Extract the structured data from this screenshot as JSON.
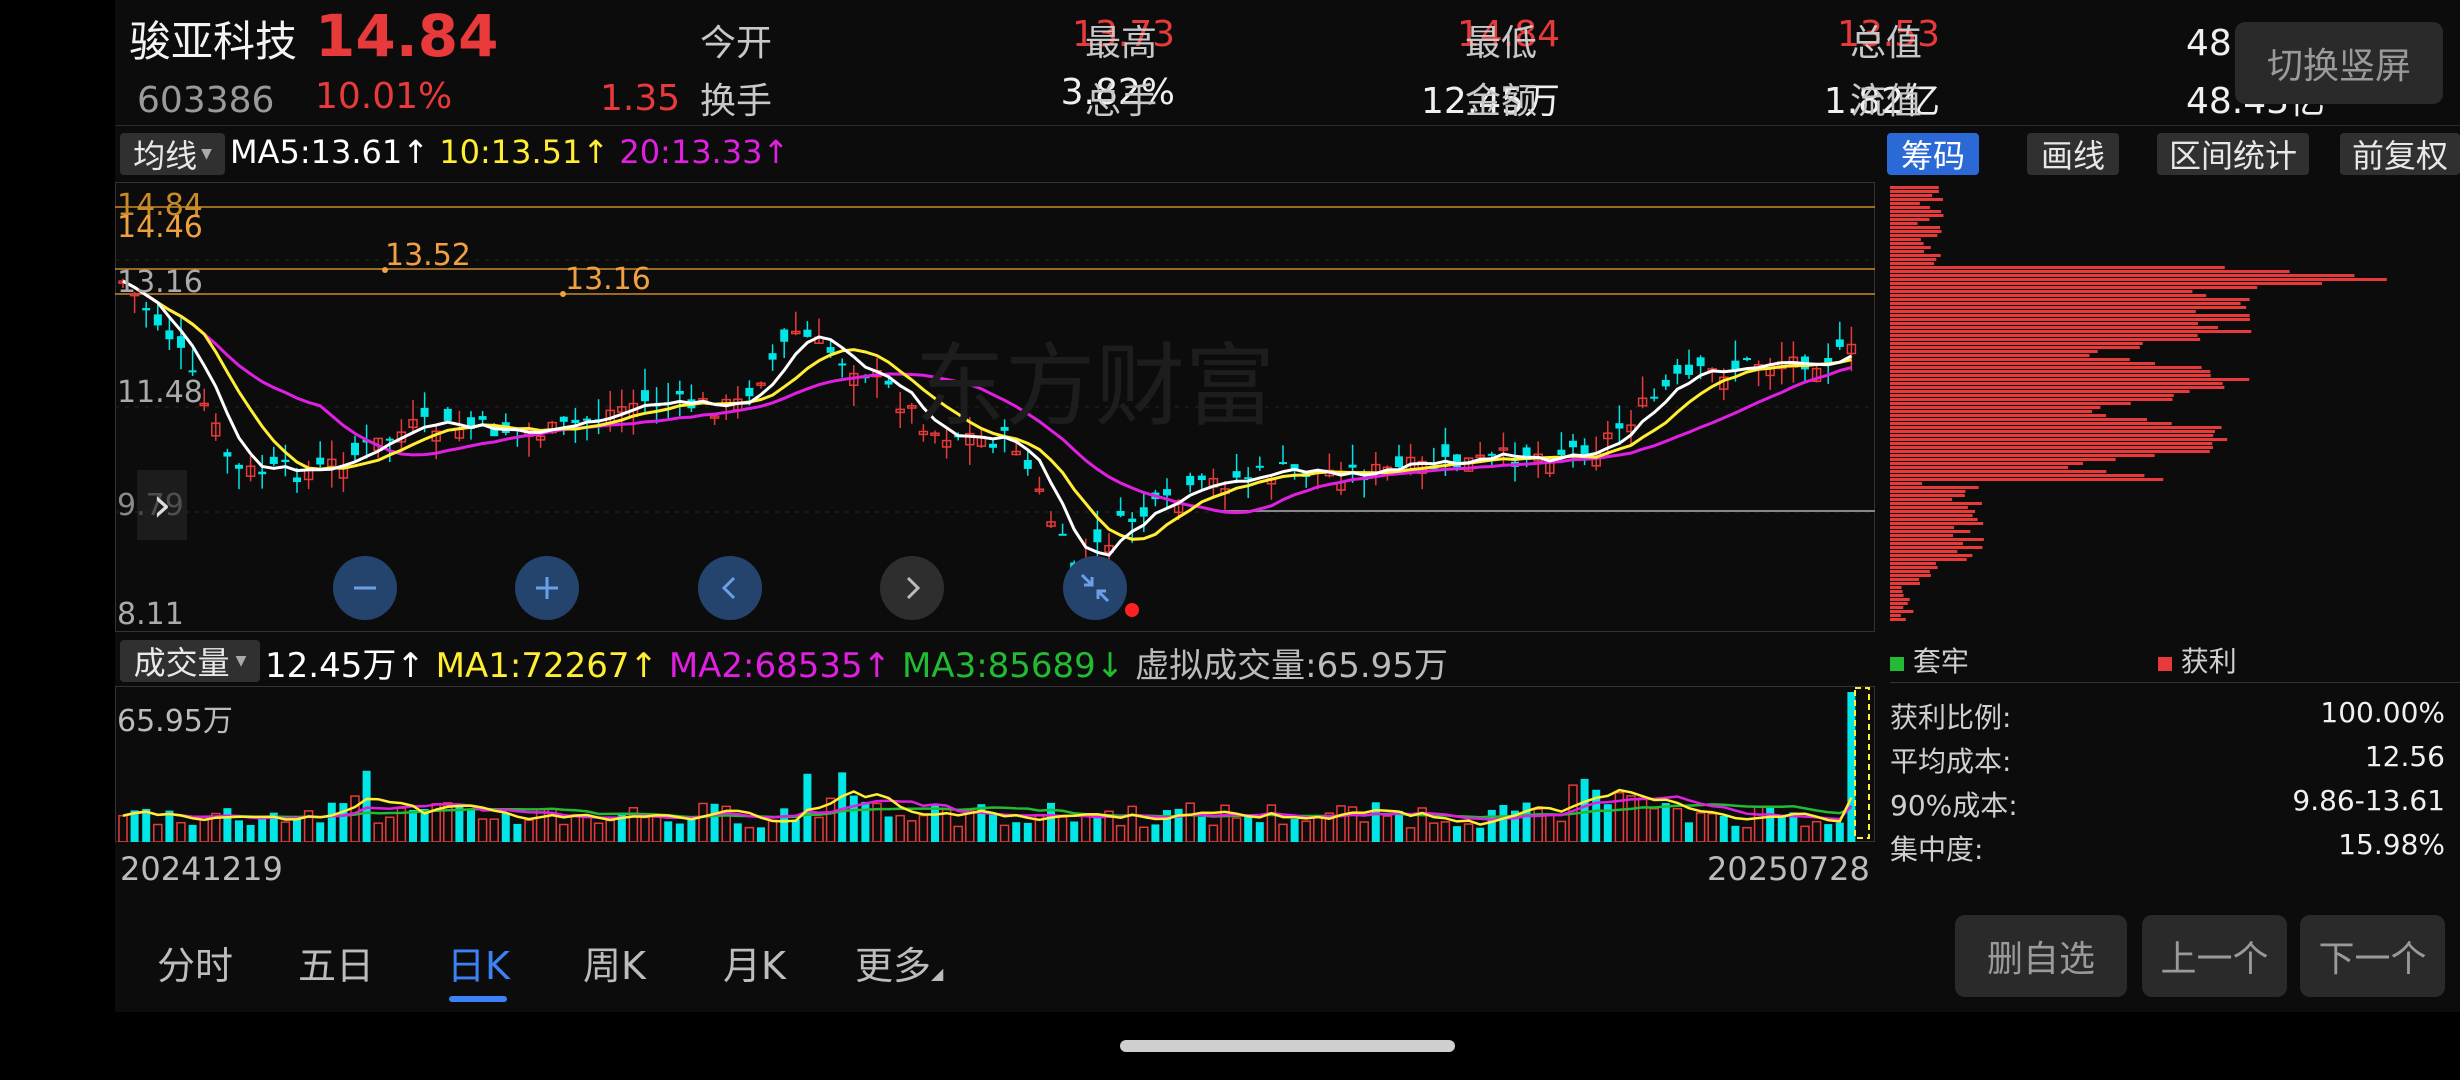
{
  "header": {
    "name": "骏亚科技",
    "price": "14.84",
    "code": "603386",
    "change_pct": "10.01%",
    "change": "1.35",
    "stats": [
      {
        "label": "今开",
        "value": "13.73",
        "color": "red"
      },
      {
        "label": "最高",
        "value": "14.84",
        "color": "red"
      },
      {
        "label": "最低",
        "value": "13.53",
        "color": "red"
      },
      {
        "label": "总值",
        "value": "48.43亿",
        "color": "white"
      },
      {
        "label": "换手",
        "value": "3.82%",
        "color": "white"
      },
      {
        "label": "总手",
        "value": "12.45万",
        "color": "white"
      },
      {
        "label": "金额",
        "value": "1.82亿",
        "color": "white"
      },
      {
        "label": "流值",
        "value": "48.43亿",
        "color": "white"
      }
    ],
    "switch_button": "切换竖屏"
  },
  "ma_bar": {
    "selector": "均线",
    "ma5": "MA5:13.61",
    "ma10": "10:13.51",
    "ma20": "20:13.33",
    "arrow": "↑"
  },
  "right_tools": [
    "筹码",
    "画线",
    "区间统计",
    "前复权"
  ],
  "price_axis": [
    "14.84",
    "14.46",
    "13.16",
    "11.48",
    "9.79",
    "8.11"
  ],
  "level_labels": [
    "13.52",
    "13.16"
  ],
  "watermark": "东方财富",
  "volume_bar": {
    "selector": "成交量",
    "vol": "12.45万",
    "ma1": "MA1:72267",
    "ma2": "MA2:68535",
    "ma3": "MA3:85689",
    "virtual": "虚拟成交量:65.95万",
    "up_arrow": "↑",
    "down_arrow": "↓",
    "axis_max": "65.95万"
  },
  "dates": {
    "start": "20241219",
    "end": "20250728"
  },
  "chip_legend": {
    "trapped": "套牢",
    "profit": "获利"
  },
  "chip_stats": [
    {
      "label": "获利比例:",
      "value": "100.00%"
    },
    {
      "label": "平均成本:",
      "value": "12.56"
    },
    {
      "label": "90%成本:",
      "value": "9.86-13.61"
    },
    {
      "label": "集中度:",
      "value": "15.98%"
    }
  ],
  "tabs": [
    "分时",
    "五日",
    "日K",
    "周K",
    "月K",
    "更多"
  ],
  "active_tab": 2,
  "bottom_buttons": [
    "删自选",
    "上一个",
    "下一个"
  ],
  "colors": {
    "up": "#e83a3a",
    "down": "#00e5e5",
    "ma5": "#ffffff",
    "ma10": "#ffee33",
    "ma20": "#e020e0",
    "ma3": "#22bb33",
    "accent": "#3b82f6"
  }
}
